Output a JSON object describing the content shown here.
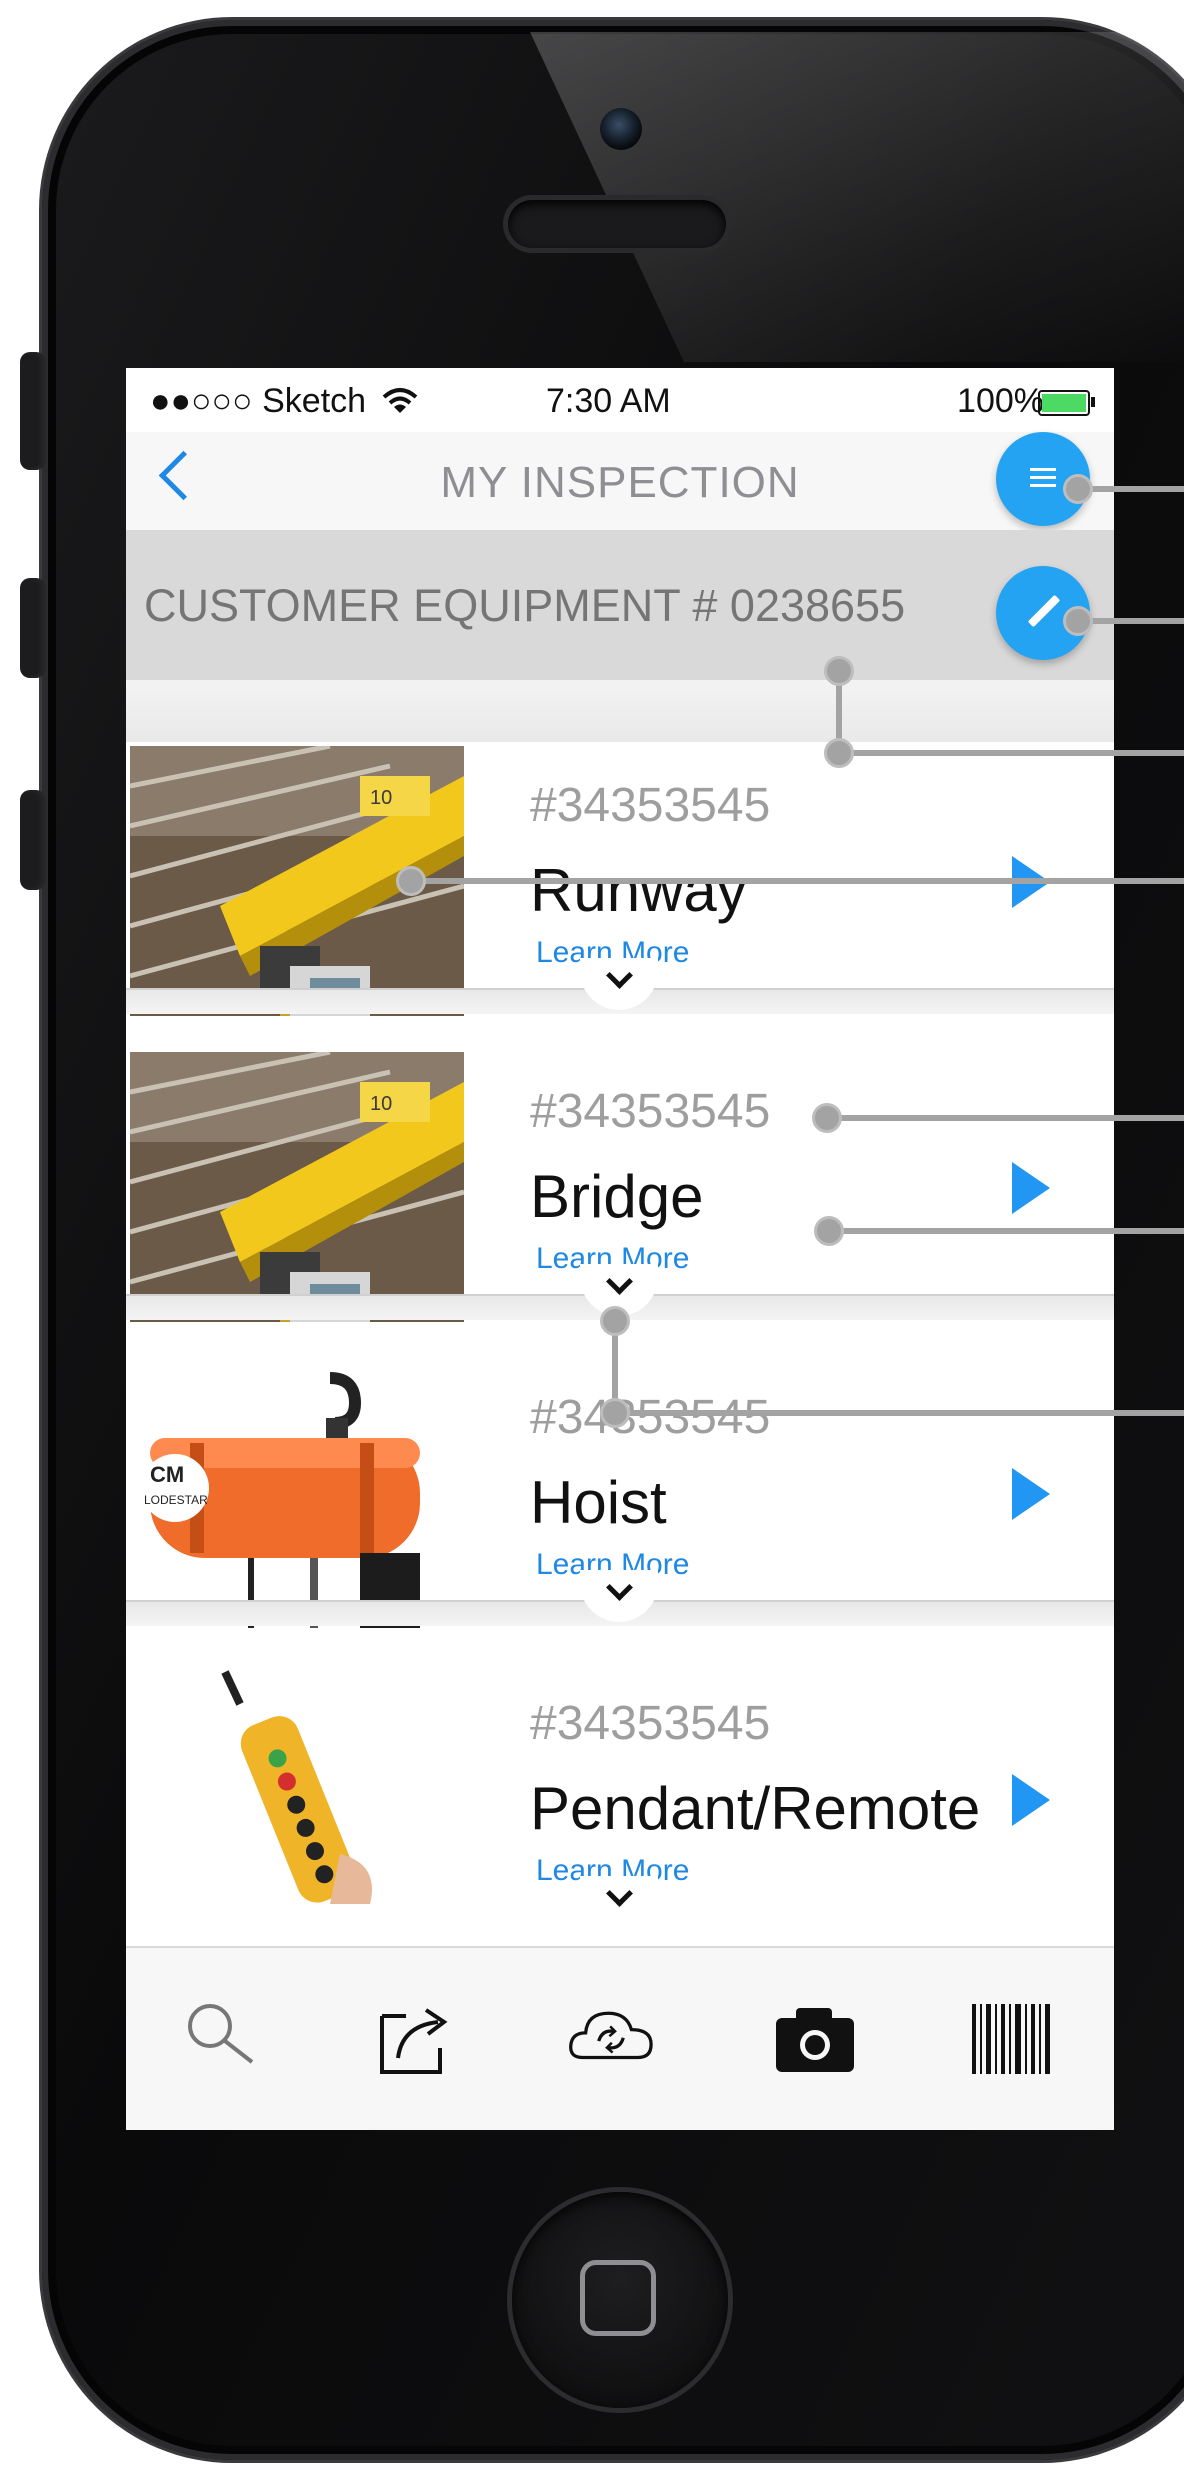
{
  "status_bar": {
    "carrier": "●●○○○ Sketch",
    "wifi_icon": "wifi-icon",
    "time": "7:30 AM",
    "battery": "100%",
    "battery_level": 1.0
  },
  "nav_bar": {
    "back_icon": "chevron-left-icon",
    "title": "MY INSPECTION",
    "menu_icon": "menu-icon"
  },
  "equipment_header": {
    "label": "CUSTOMER EQUIPMENT # 0238655",
    "edit_icon": "pencil-icon"
  },
  "items": [
    {
      "number": "#34353545",
      "name": "Runway",
      "link": "Learn More",
      "image": "crane-runway-photo"
    },
    {
      "number": "#34353545",
      "name": "Bridge",
      "link": "Learn More",
      "image": "crane-bridge-photo"
    },
    {
      "number": "#34353545",
      "name": "Hoist",
      "link": "Learn More",
      "image": "hoist-photo"
    },
    {
      "number": "#34353545",
      "name": "Pendant/Remote",
      "link": "Learn More",
      "image": "pendant-remote-photo"
    }
  ],
  "hoist_label": "CM LODESTAR",
  "tab_bar": [
    "search-icon",
    "share-icon",
    "cloud-sync-icon",
    "camera-icon",
    "barcode-icon"
  ],
  "colors": {
    "accent": "#1e88e5",
    "fab": "#23a3f2",
    "header_bg": "#d9d9d9",
    "callout": "#a3a3a3"
  }
}
